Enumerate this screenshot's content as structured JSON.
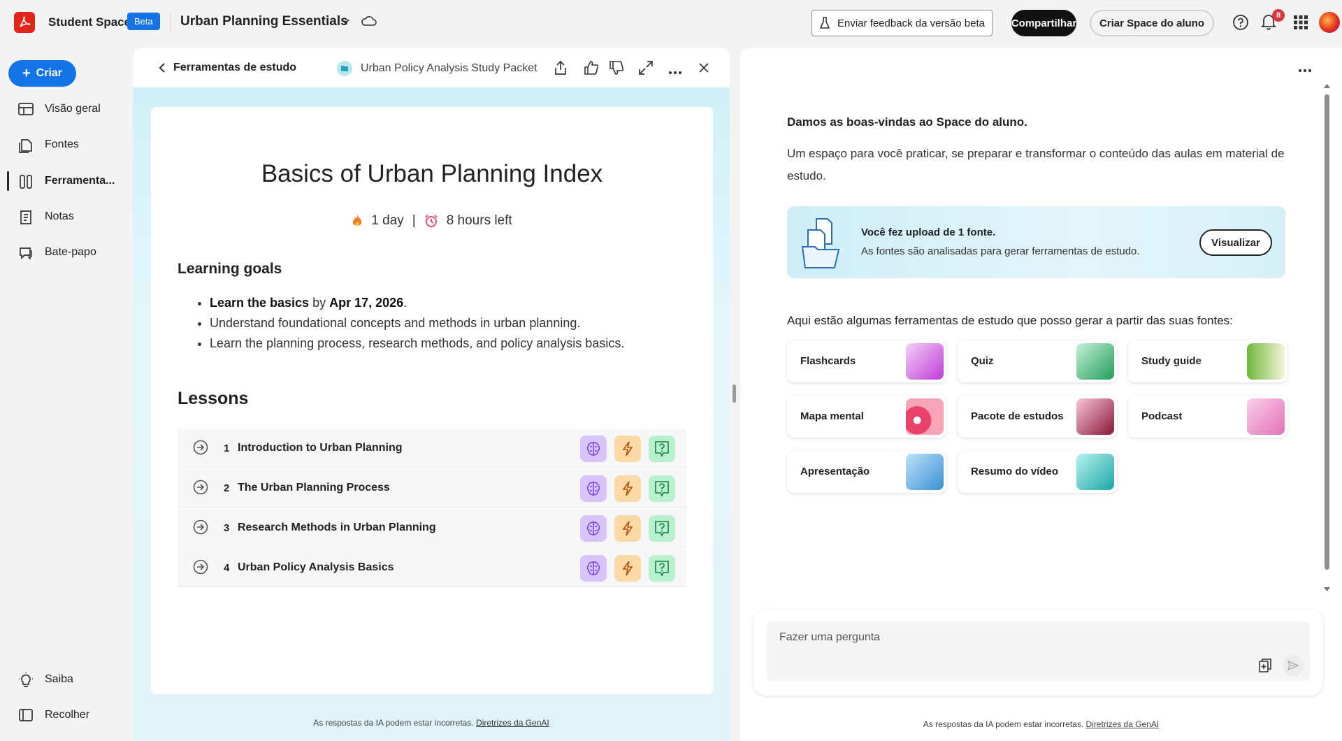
{
  "header": {
    "app_name": "Student Spaces",
    "beta": "Beta",
    "space_title": "Urban Planning Essentials",
    "feedback": "Enviar feedback da versão beta",
    "share": "Compartilhar",
    "create_space": "Criar Space do aluno",
    "notifications_count": "8"
  },
  "sidebar": {
    "create": "Criar",
    "items": [
      {
        "label": "Visão geral",
        "icon": "overview-icon"
      },
      {
        "label": "Fontes",
        "icon": "sources-icon"
      },
      {
        "label": "Ferramenta...",
        "icon": "tools-icon"
      },
      {
        "label": "Notas",
        "icon": "notes-icon"
      },
      {
        "label": "Bate-papo",
        "icon": "chat-icon"
      }
    ],
    "learn": "Saiba",
    "collapse": "Recolher"
  },
  "study": {
    "back": "Ferramentas de estudo",
    "packet": "Urban Policy Analysis Study Packet",
    "title": "Basics of Urban Planning Index",
    "streak": "1 day",
    "separator": "|",
    "time_left": "8 hours left",
    "goals_heading": "Learning goals",
    "goal1_bold": "Learn the basics",
    "goal1_by": "by",
    "goal1_date": "Apr 17, 2026",
    "goal1_end": ".",
    "goal2": "Understand foundational concepts and methods in urban planning.",
    "goal3": "Learn the planning process, research methods, and policy analysis basics.",
    "lessons_heading": "Lessons",
    "lessons": [
      {
        "num": "1",
        "title": "Introduction to Urban Planning"
      },
      {
        "num": "2",
        "title": "The Urban Planning Process"
      },
      {
        "num": "3",
        "title": "Research Methods in Urban Planning"
      },
      {
        "num": "4",
        "title": "Urban Policy Analysis Basics"
      }
    ],
    "footer_text": "As respostas da IA podem estar incorretas.",
    "footer_link": "Diretrizes da GenAI"
  },
  "assistant": {
    "welcome_title": "Damos as boas-vindas ao Space do aluno.",
    "welcome_body": "Um espaço para você praticar, se preparar e transformar o conteúdo das aulas em material de estudo.",
    "upload_title": "Você fez upload de 1 fonte.",
    "upload_sub": "As fontes são analisadas para gerar ferramentas de estudo.",
    "view": "Visualizar",
    "tools_heading": "Aqui estão algumas ferramentas de estudo que posso gerar a partir das suas fontes:",
    "tools": [
      {
        "label": "Flashcards",
        "color": "#c13bd8"
      },
      {
        "label": "Quiz",
        "color": "#1e9e5a"
      },
      {
        "label": "Study guide",
        "color": "#6fb83a"
      },
      {
        "label": "Mapa mental",
        "color": "#e8426b"
      },
      {
        "label": "Pacote de estudos",
        "color": "#8a1538"
      },
      {
        "label": "Podcast",
        "color": "#e46fb8"
      },
      {
        "label": "Apresentação",
        "color": "#3a8fd6"
      },
      {
        "label": "Resumo do vídeo",
        "color": "#1aa7a7"
      }
    ],
    "chat_placeholder": "Fazer uma pergunta",
    "footer_text": "As respostas da IA podem estar incorretas.",
    "footer_link": "Diretrizes da GenAI"
  }
}
